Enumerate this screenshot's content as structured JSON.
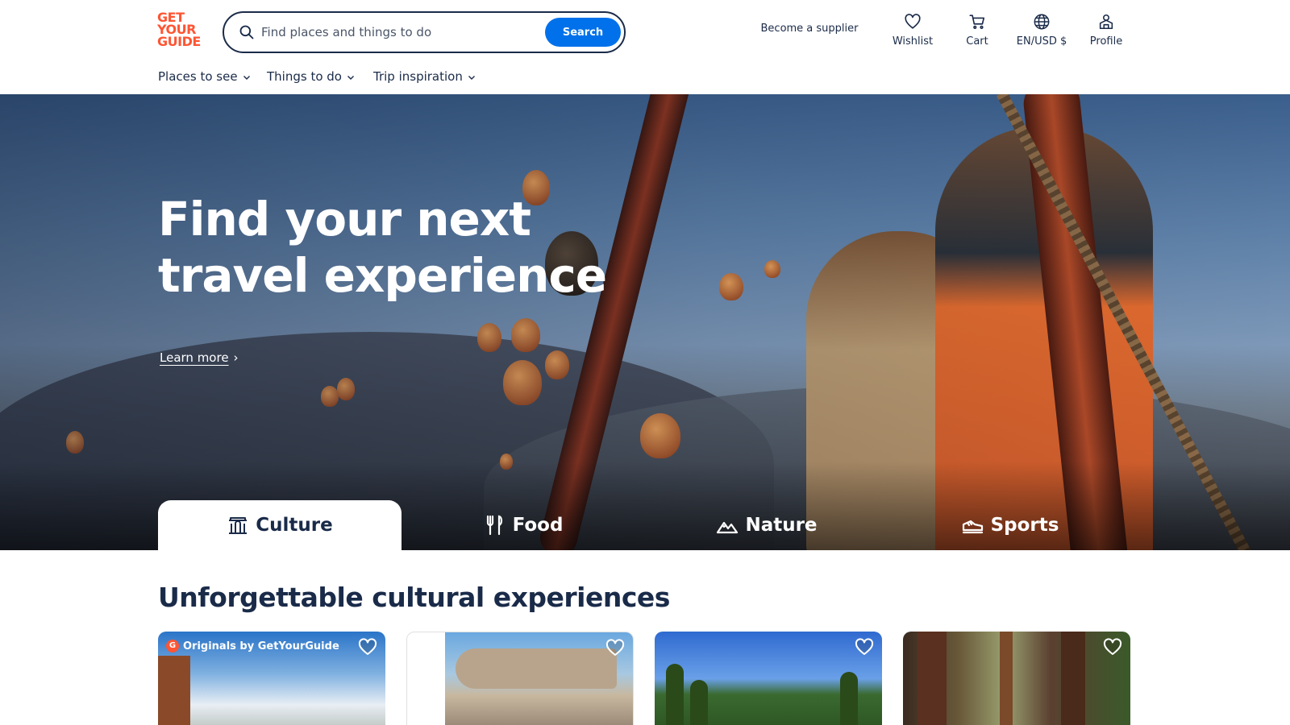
{
  "logo": {
    "lines": [
      "GET",
      "YOUR",
      "GUIDE"
    ]
  },
  "search": {
    "placeholder": "Find places and things to do",
    "button_label": "Search"
  },
  "header_actions": {
    "supplier_label": "Become a supplier",
    "wishlist_label": "Wishlist",
    "cart_label": "Cart",
    "locale_label": "EN/USD $",
    "profile_label": "Profile"
  },
  "subnav": {
    "items": [
      {
        "label": "Places to see"
      },
      {
        "label": "Things to do"
      },
      {
        "label": "Trip inspiration"
      }
    ]
  },
  "hero": {
    "title": "Find your next travel experience",
    "learn_more": "Learn more",
    "learn_more_arrow": "›"
  },
  "categories": {
    "active": "Culture",
    "tabs": [
      {
        "label": "Culture",
        "icon": "museum-icon"
      },
      {
        "label": "Food",
        "icon": "fork-knife-icon"
      },
      {
        "label": "Nature",
        "icon": "mountain-icon"
      },
      {
        "label": "Sports",
        "icon": "sneaker-icon"
      }
    ]
  },
  "section": {
    "title": "Unforgettable cultural experiences",
    "cards": [
      {
        "badge": "Originals by GetYourGuide",
        "badge_icon": "G"
      },
      {},
      {},
      {}
    ]
  },
  "colors": {
    "brand": "#ff5533",
    "primary_text": "#1a2b49",
    "search_button": "#0071eb"
  }
}
